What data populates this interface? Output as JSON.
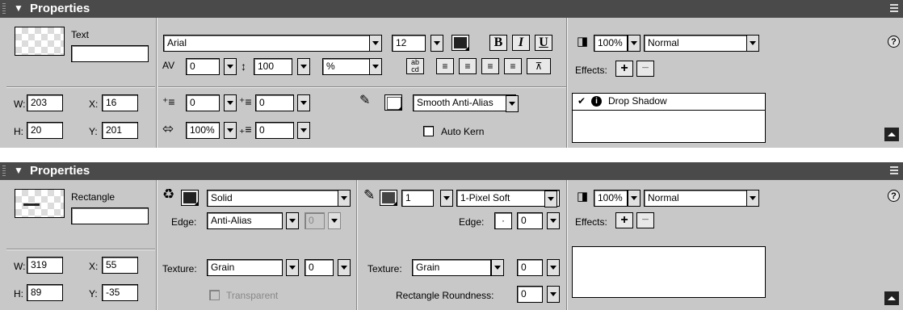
{
  "panel1": {
    "title": "Properties",
    "object_type": "Text",
    "name_value": "",
    "w_label": "W:",
    "w_value": "203",
    "h_label": "H:",
    "h_value": "20",
    "x_label": "X:",
    "x_value": "16",
    "y_label": "Y:",
    "y_value": "201",
    "font": "Arial",
    "font_size": "12",
    "bold": "B",
    "italic": "I",
    "underline": "U",
    "kerning": "0",
    "leading": "100",
    "leading_unit": "%",
    "indent": "0",
    "space_before": "0",
    "horizontal_scale": "100%",
    "space_after": "0",
    "antialias": "Smooth Anti-Alias",
    "autokern_label": "Auto Kern",
    "opacity": "100%",
    "blend": "Normal",
    "effects_label": "Effects:",
    "effects": [
      {
        "name": "Drop Shadow"
      }
    ]
  },
  "panel2": {
    "title": "Properties",
    "object_type": "Rectangle",
    "name_value": "",
    "w_label": "W:",
    "w_value": "319",
    "h_label": "H:",
    "h_value": "89",
    "x_label": "X:",
    "x_value": "55",
    "y_label": "Y:",
    "y_value": "-35",
    "fill_type": "Solid",
    "edge_label": "Edge:",
    "fill_edge": "Anti-Alias",
    "fill_edge_amount": "0",
    "texture_label": "Texture:",
    "fill_texture": "Grain",
    "fill_texture_amount": "0",
    "transparent_label": "Transparent",
    "stroke_size": "1",
    "stroke_type": "1-Pixel Soft",
    "stroke_edge_label": "Edge:",
    "stroke_edge_amount": "0",
    "stroke_texture_label": "Texture:",
    "stroke_texture": "Grain",
    "stroke_texture_amount": "0",
    "roundness_label": "Rectangle Roundness:",
    "roundness": "0",
    "opacity": "100%",
    "blend": "Normal",
    "effects_label": "Effects:"
  },
  "icons": {
    "help": "?",
    "plus": "+",
    "minus": "−",
    "check": "✔",
    "info": "i"
  }
}
